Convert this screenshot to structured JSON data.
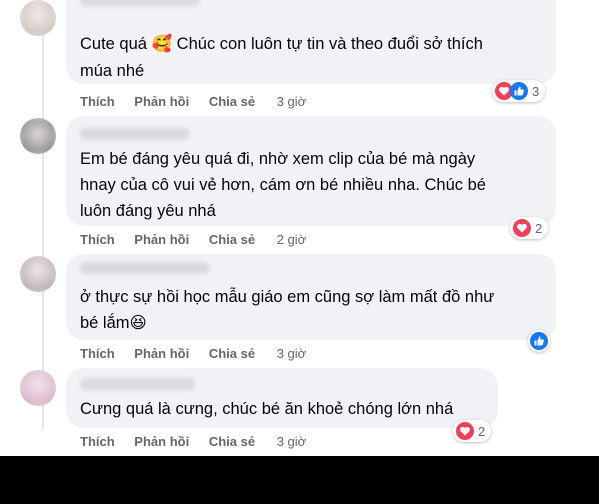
{
  "actions": {
    "like": "Thích",
    "reply": "Phản hồi",
    "share": "Chia sẻ"
  },
  "comments": [
    {
      "lines": [
        "Cute quá 🥰  Chúc con luôn tự tin và theo đuổi sở thích",
        "múa nhé"
      ],
      "time": "3 giờ",
      "reactions": [
        "like",
        "heart"
      ],
      "reaction_count": "3"
    },
    {
      "lines": [
        "Em bé đáng yêu quá đi, nhờ xem clip của bé mà ngày",
        "hnay của cô vui vẻ hơn, cám ơn bé nhiều nha. Chúc bé",
        "luôn đáng yêu nhá"
      ],
      "time": "2 giờ",
      "reactions": [
        "heart"
      ],
      "reaction_count": "2"
    },
    {
      "lines": [
        "ở thực sự hồi học mẫu giáo em cũng sợ làm mất đồ như",
        "bé lắm😆"
      ],
      "time": "3 giờ",
      "reactions": [
        "like"
      ],
      "reaction_count": ""
    },
    {
      "lines": [
        "Cưng quá là cưng, chúc bé ăn khoẻ chóng lớn nhá"
      ],
      "time": "3 giờ",
      "reactions": [
        "heart"
      ],
      "reaction_count": "2"
    }
  ],
  "colors": {
    "bubble": "#f0f2f5",
    "heart": "#f33e58",
    "like": "#1877f2",
    "meta": "#65676b"
  },
  "icons": {
    "heart": "heart-icon",
    "like": "thumbs-up-icon"
  }
}
